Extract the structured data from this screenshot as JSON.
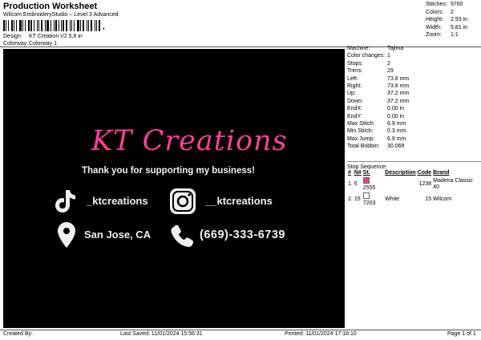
{
  "header": {
    "title": "Production Worksheet",
    "subtitle": "Wilcom EmbroideryStudio – Level 3 Advanced",
    "barcode_mark": ","
  },
  "meta": {
    "design_label": "Design:",
    "design_value": "KT Creation V2 5,8 in",
    "colorway_label": "Colorway:",
    "colorway_value": "Colorway 1"
  },
  "stats": [
    {
      "label": "Stitches:",
      "value": "9760"
    },
    {
      "label": "Colors:",
      "value": "2"
    },
    {
      "label": "Height:",
      "value": "2.93 in"
    },
    {
      "label": "Width:",
      "value": "5.81 in"
    },
    {
      "label": "Zoom:",
      "value": "1:1"
    }
  ],
  "design": {
    "brand_text": "KT Creations",
    "tagline": "Thank you for supporting my business!",
    "tiktok_handle": "_ktcreations",
    "instagram_handle": "__ktcreations",
    "location": "San Jose, CA",
    "phone": "(669)-333-6739",
    "pink": "#ff3e9a",
    "white": "#f0f0f0"
  },
  "machine_info": [
    {
      "label": "Machine:",
      "value": "Tajima"
    },
    {
      "label": "Color changes:",
      "value": "1"
    },
    {
      "label": "Stops:",
      "value": "2"
    },
    {
      "label": "Trims:",
      "value": "29"
    },
    {
      "label": "Left:",
      "value": "73.8 mm"
    },
    {
      "label": "Right:",
      "value": "73.8 mm"
    },
    {
      "label": "Up:",
      "value": "37.2 mm"
    },
    {
      "label": "Down:",
      "value": "37.2 mm"
    },
    {
      "label": "EndX:",
      "value": "0.00 in"
    },
    {
      "label": "EndY:",
      "value": "0.00 in"
    },
    {
      "label": "Max Stitch:",
      "value": "6.9 mm"
    },
    {
      "label": "Min Stitch:",
      "value": "0.3 mm"
    },
    {
      "label": "Max Jump:",
      "value": "6.9 mm"
    },
    {
      "label": "Total Bobbin:",
      "value": "30.06ft"
    }
  ],
  "stop_sequence": {
    "title": "Stop Sequence:",
    "headers": [
      "#",
      "N#",
      "St.",
      "Description",
      "Code",
      "Brand"
    ],
    "rows": [
      {
        "num": "1.",
        "needle": "6",
        "stitches": "2555",
        "description": "",
        "code": "1238",
        "brand": "Madeira Classic 40",
        "color": "#e8418e"
      },
      {
        "num": "2.",
        "needle": "15",
        "stitches": "7203",
        "description": "White",
        "code": "15",
        "brand": "Wilcom",
        "color": "#ffffff"
      }
    ]
  },
  "footer": {
    "created_by": "Created By:",
    "last_saved": "Last Saved: 11/01/2024 15:56:31",
    "printed": "Printed: 11/01/2024 17:18:10",
    "page": "Page 1 of 1"
  }
}
